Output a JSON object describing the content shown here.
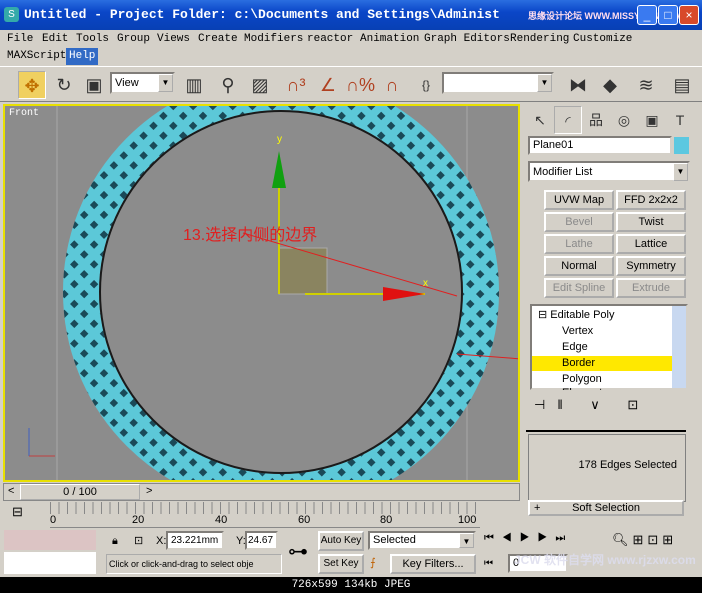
{
  "window": {
    "title": "Untitled    - Project Folder: c:\\Documents and Settings\\Administ",
    "watermark_top": "思缘设计论坛 WWW.MISSYUAN.COM"
  },
  "menu": [
    "File",
    "Edit",
    "Tools",
    "Group",
    "Views",
    "Create",
    "Modifiers",
    "reactor",
    "Animation",
    "Graph Editors",
    "Rendering",
    "Customize",
    "MAXScript",
    "Help"
  ],
  "menu_active": "Help",
  "toolbar": {
    "coord_system": "View",
    "named_selection": ""
  },
  "viewport": {
    "label": "Front",
    "annotation": "13.选择内侧的边界",
    "gizmo_y": "y",
    "gizmo_x": "x"
  },
  "command_panel": {
    "tabs": [
      "create-icon",
      "modify-icon",
      "hierarchy-icon",
      "motion-icon",
      "display-icon",
      "utilities-icon"
    ],
    "object_name": "Plane01",
    "object_color": "#5cc8e0",
    "modifier_list": "Modifier List",
    "modifier_buttons": [
      {
        "label": "UVW Map",
        "enabled": true
      },
      {
        "label": "FFD 2x2x2",
        "enabled": true
      },
      {
        "label": "Bevel",
        "enabled": false
      },
      {
        "label": "Twist",
        "enabled": true
      },
      {
        "label": "Lathe",
        "enabled": false
      },
      {
        "label": "Lattice",
        "enabled": true
      },
      {
        "label": "Normal",
        "enabled": true
      },
      {
        "label": "Symmetry",
        "enabled": true
      },
      {
        "label": "Edit Spline",
        "enabled": false
      },
      {
        "label": "Extrude",
        "enabled": false
      }
    ],
    "stack": {
      "root": "Editable Poly",
      "items": [
        "Vertex",
        "Edge",
        "Border",
        "Polygon",
        "Element"
      ],
      "selected": "Border"
    },
    "selection_status": "178 Edges Selected",
    "rollout": "Soft Selection"
  },
  "timeline": {
    "frame_display": "0 / 100",
    "ticks": [
      "0",
      "20",
      "40",
      "60",
      "80",
      "100"
    ]
  },
  "status": {
    "x": "23.221mm",
    "y": "24.67",
    "x_label": "X:",
    "y_label": "Y:",
    "prompt": "Click or click-and-drag to select obje",
    "auto_key": "Auto Key",
    "set_key": "Set Key",
    "key_mode": "Selected",
    "key_filters": "Key Filters...",
    "current_frame": "0"
  },
  "viewer_caption": "726x599  134kb  JPEG",
  "watermark_bottom": "JCW 软件自学网 www.rjzxw.com"
}
